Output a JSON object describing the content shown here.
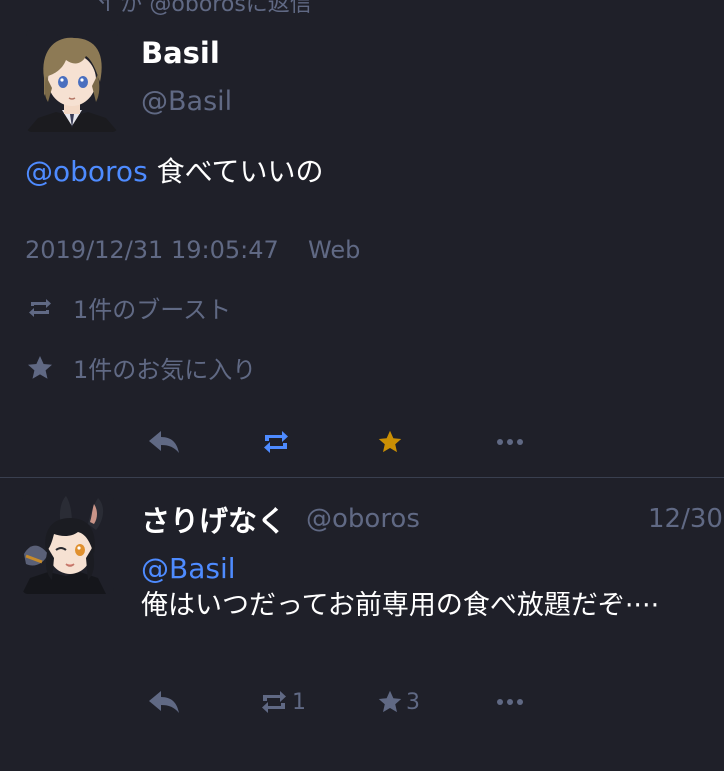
{
  "top_partial": "↰ が @oborosに返信",
  "main_status": {
    "display_name": "Basil",
    "acct": "@Basil",
    "mention": "@oboros",
    "content": "食べていいの",
    "timestamp": "2019/12/31 19:05:47",
    "application": "Web",
    "boosts_label": "1件のブースト",
    "favourites_label": "1件のお気に入り",
    "action_icons": [
      "reply-icon",
      "boost-icon",
      "favourite-icon",
      "more-icon"
    ],
    "boosted": true,
    "favourited": true
  },
  "reply_status": {
    "display_name": "さりげなく",
    "acct": "@oboros",
    "time": "12/30",
    "mention": "@Basil",
    "content": "俺はいつだってお前専用の食べ放題だぞ····",
    "boost_count": "1",
    "favourite_count": "3"
  },
  "colors": {
    "background": "#1f2029",
    "text": "#ffffff",
    "muted": "#606984",
    "link": "#4e8bff",
    "boost_active": "#4e8bff",
    "favourite_active": "#ca8f04",
    "divider": "#393f4f"
  }
}
